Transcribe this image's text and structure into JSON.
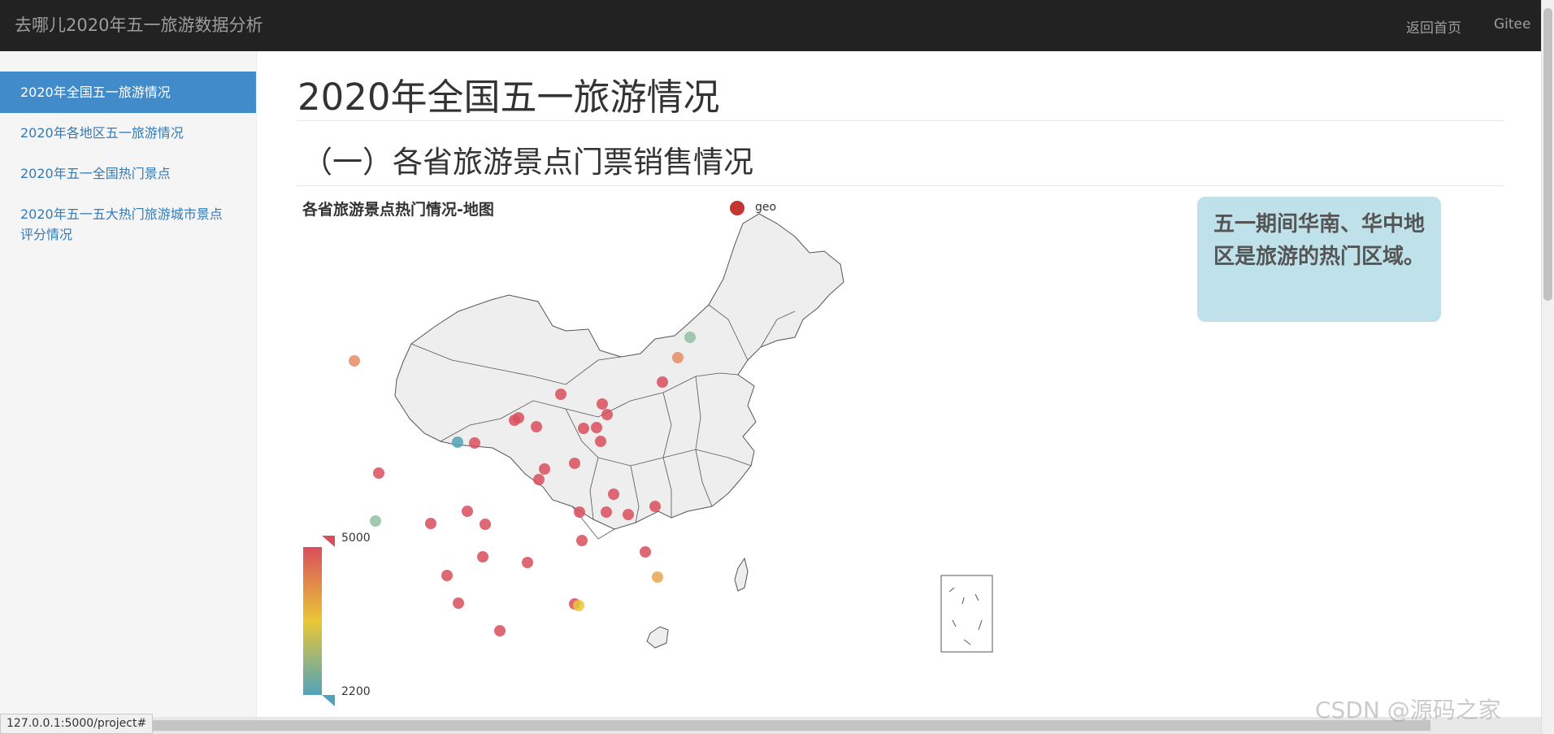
{
  "navbar": {
    "brand": "去哪儿2020年五一旅游数据分析",
    "links": [
      "返回首页",
      "Gitee"
    ]
  },
  "sidebar": {
    "items": [
      {
        "label": "2020年全国五一旅游情况",
        "active": true
      },
      {
        "label": "2020年各地区五一旅游情况",
        "active": false
      },
      {
        "label": "2020年五一全国热门景点",
        "active": false
      },
      {
        "label": "2020年五一五大热门旅游城市景点",
        "label2": "评分情况",
        "active": false
      }
    ]
  },
  "main": {
    "title": "2020年全国五一旅游情况",
    "section_title": "（一）各省旅游景点门票销售情况",
    "callout": "五一期间华南、华中地区是旅游的热门区域。"
  },
  "chart_data": {
    "type": "scatter",
    "title": "各省旅游景点热门情况-地图",
    "legend": [
      "geo"
    ],
    "legend_color": "#c23531",
    "visual_map": {
      "max": 5000,
      "min": 2200,
      "colors": [
        "#d94e5d",
        "#eac736",
        "#50a3ba"
      ]
    },
    "map": "china"
  },
  "statusbar": {
    "url": "127.0.0.1:5000/project#"
  },
  "watermark": "CSDN @源码之家"
}
